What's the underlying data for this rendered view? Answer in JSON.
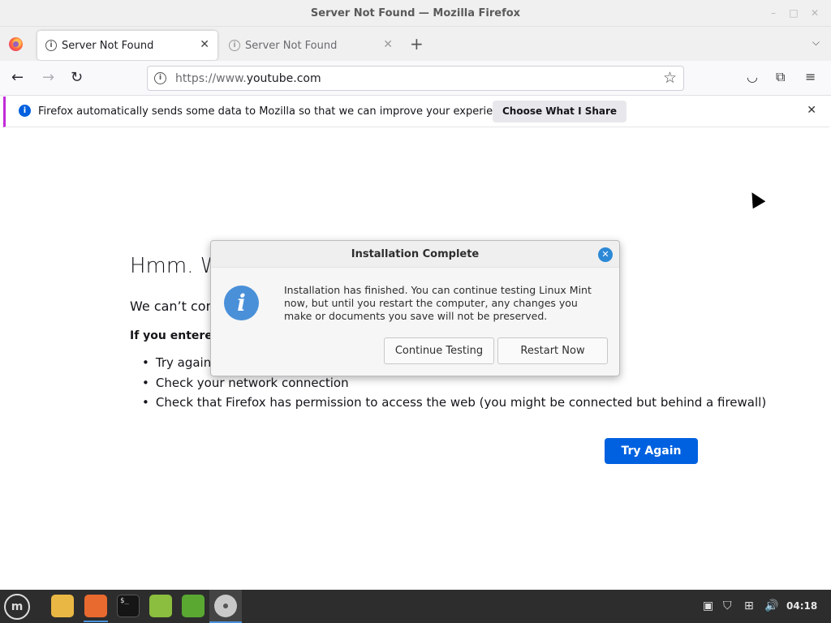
{
  "window": {
    "title": "Server Not Found — Mozilla Firefox",
    "minimize_icon": "minimize-icon",
    "maximize_icon": "maximize-icon",
    "close_icon": "close-icon"
  },
  "tabs": [
    {
      "label": "Server Not Found",
      "active": true
    },
    {
      "label": "Server Not Found",
      "active": false
    }
  ],
  "navbar": {
    "url_prefix": "https://www.",
    "url_domain": "youtube.com"
  },
  "notification": {
    "message": "Firefox automatically sends some data to Mozilla so that we can improve your experience.",
    "button_label": "Choose What I Share"
  },
  "error_page": {
    "title": "Hmm. We’re having trouble finding that site.",
    "subtitle": "We can’t connect to the server at www.youtube.com.",
    "strong": "If you entered the right address, you can:",
    "items": [
      "Try again later",
      "Check your network connection",
      "Check that Firefox has permission to access the web (you might be connected but behind a firewall)"
    ],
    "visible_title": "Hmm. W",
    "visible_subtitle": "We can’t con",
    "visible_strong": "If you entered",
    "visible_item_0": "Try again l",
    "try_again_label": "Try Again"
  },
  "dialog": {
    "title": "Installation Complete",
    "message": "Installation has finished.  You can continue testing Linux Mint now, but until you restart the computer, any changes you make or documents you save will not be preserved.",
    "continue_label": "Continue Testing",
    "restart_label": "Restart Now"
  },
  "taskbar": {
    "clock": "04:18",
    "apps": [
      "files",
      "firefox",
      "terminal",
      "mintinstall",
      "mintupdate",
      "install-linux-mint"
    ]
  },
  "colors": {
    "accent": "#0061e0",
    "notification_stripe": "#c12bd8",
    "dialog_icon": "#4a90d9"
  }
}
